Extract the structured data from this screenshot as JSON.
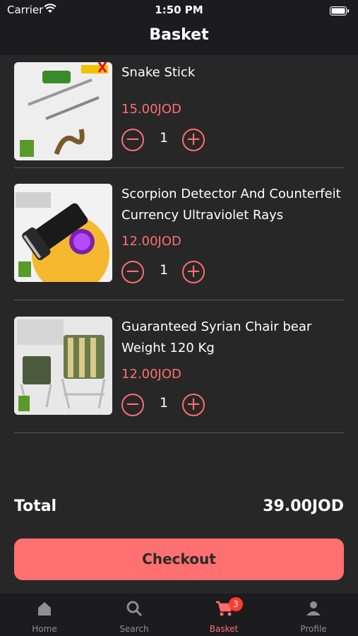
{
  "status_bar": {
    "carrier": "Carrier",
    "time": "1:50 PM"
  },
  "header": {
    "title": "Basket"
  },
  "basket": {
    "items": [
      {
        "name": "Snake Stick",
        "price": "15.00JOD",
        "quantity": "1",
        "image": "snake-stick-image"
      },
      {
        "name": "Scorpion Detector And Counterfeit Currency Ultraviolet Rays",
        "price": "12.00JOD",
        "quantity": "1",
        "image": "uv-flashlight-image"
      },
      {
        "name": "Guaranteed Syrian Chair bear Weight 120  Kg",
        "price": "12.00JOD",
        "quantity": "1",
        "image": "folding-chairs-image"
      }
    ],
    "minus_icon": "minus-circle-icon",
    "plus_icon": "plus-circle-icon"
  },
  "summary": {
    "total_label": "Total",
    "total_value": "39.00JOD"
  },
  "checkout": {
    "label": "Checkout"
  },
  "tabbar": {
    "tabs": [
      {
        "label": "Home",
        "icon": "home-icon"
      },
      {
        "label": "Search",
        "icon": "search-icon"
      },
      {
        "label": "Basket",
        "icon": "cart-icon",
        "badge": "3",
        "active": true
      },
      {
        "label": "Profile",
        "icon": "person-icon"
      }
    ]
  },
  "colors": {
    "accent": "#ff6e6e",
    "background": "#272728",
    "bar": "#1c1c1e",
    "inactive": "#8e8e93"
  }
}
